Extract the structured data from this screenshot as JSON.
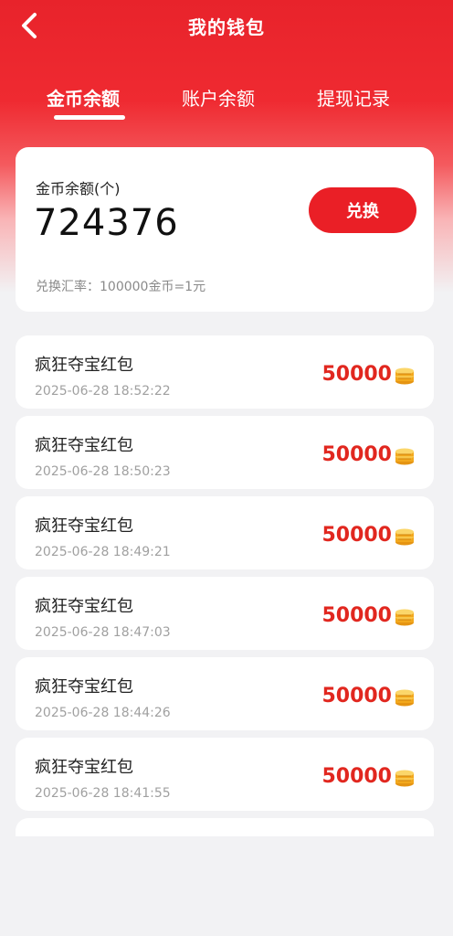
{
  "header": {
    "title": "我的钱包"
  },
  "tabs": [
    {
      "label": "金币余额",
      "active": true
    },
    {
      "label": "账户余额",
      "active": false
    },
    {
      "label": "提现记录",
      "active": false
    }
  ],
  "balance": {
    "label": "金币余额(个)",
    "value": "724376",
    "exchange_label": "兑换",
    "rate_text": "兑换汇率：100000金币=1元"
  },
  "records": [
    {
      "title": "疯狂夺宝红包",
      "time": "2025-06-28 18:52:22",
      "amount": "50000"
    },
    {
      "title": "疯狂夺宝红包",
      "time": "2025-06-28 18:50:23",
      "amount": "50000"
    },
    {
      "title": "疯狂夺宝红包",
      "time": "2025-06-28 18:49:21",
      "amount": "50000"
    },
    {
      "title": "疯狂夺宝红包",
      "time": "2025-06-28 18:47:03",
      "amount": "50000"
    },
    {
      "title": "疯狂夺宝红包",
      "time": "2025-06-28 18:44:26",
      "amount": "50000"
    },
    {
      "title": "疯狂夺宝红包",
      "time": "2025-06-28 18:41:55",
      "amount": "50000"
    }
  ],
  "colors": {
    "brand_red": "#e8232b",
    "amount_red": "#e1271f",
    "coin_gold": "#f2a81d"
  },
  "icons": {
    "back": "chevron-left-icon",
    "coin": "coin-stack-icon"
  }
}
